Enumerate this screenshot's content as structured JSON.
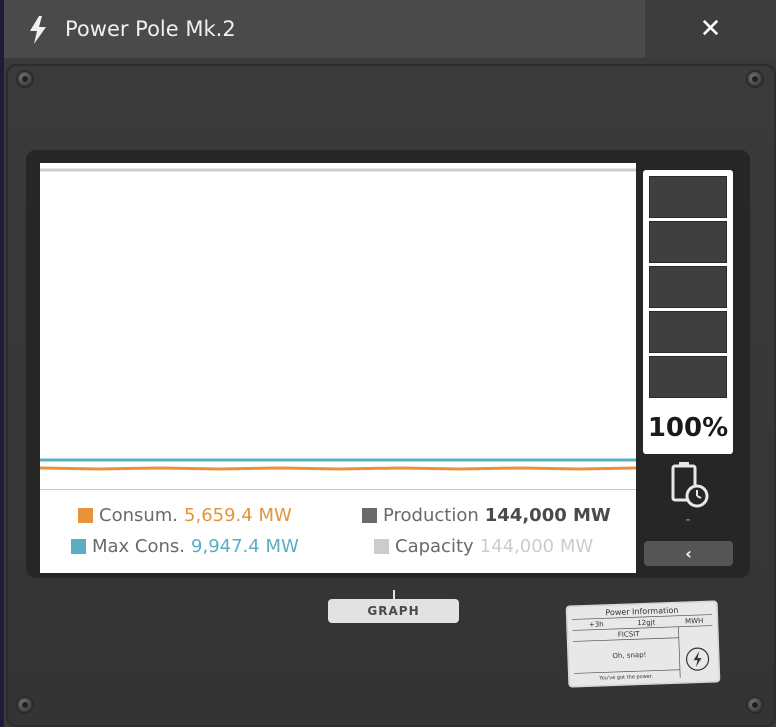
{
  "window": {
    "title": "Power Pole Mk.2",
    "close_label": "✕"
  },
  "legend": {
    "consumption": {
      "label": "Consum.",
      "value": "5,659.4 MW",
      "color": "#e8923a"
    },
    "production": {
      "label": "Production",
      "value": "144,000 MW",
      "color": "#6a6a6a"
    },
    "max_consumption": {
      "label": "Max Cons.",
      "value": "9,947.4 MW",
      "color": "#5aaec4"
    },
    "capacity": {
      "label": "Capacity",
      "value": "144,000 MW",
      "color": "#cccccc"
    }
  },
  "battery": {
    "percent_label": "100%",
    "fill_fraction": 1.0,
    "segments": 5,
    "sub_label": "-"
  },
  "buttons": {
    "back_label": "‹",
    "graph_tab_label": "GRAPH"
  },
  "sticker": {
    "header": "Power Information",
    "row1": [
      "+3h",
      "12gjt",
      "MWH"
    ],
    "company": "FICSIT",
    "message": "Oh, snap!",
    "footer": "You've got the power."
  },
  "icons": [
    "lightning-icon",
    "close-icon",
    "battery-timer-icon",
    "chevron-left-icon",
    "power-symbol-icon"
  ]
}
